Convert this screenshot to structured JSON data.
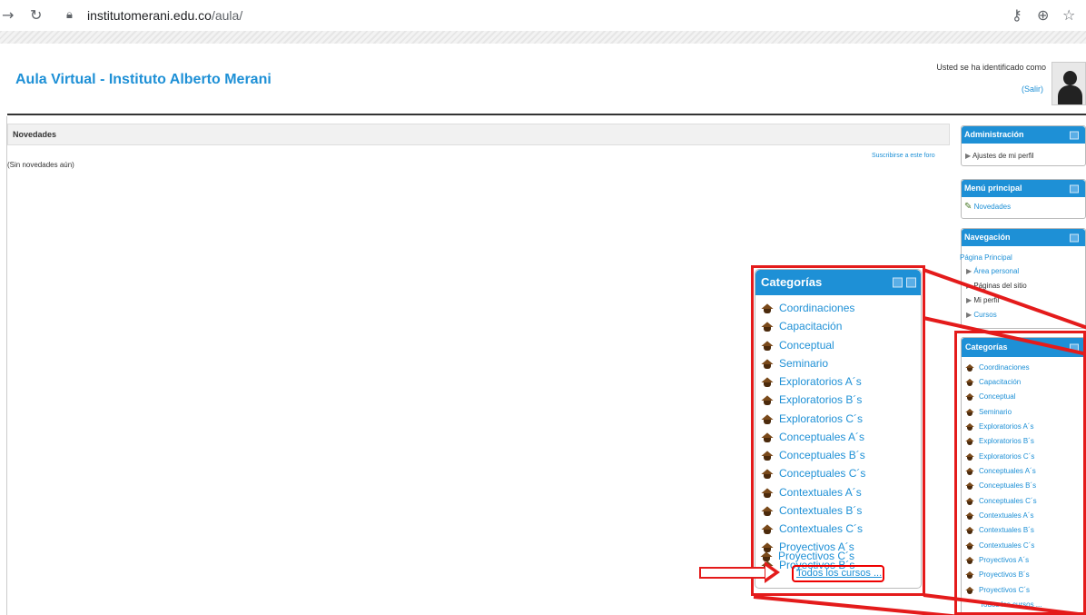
{
  "browser": {
    "back_icon": "back-arrow-icon",
    "reload_icon": "reload-icon",
    "lock_icon": "lock-icon",
    "url_domain": "institutomerani.edu.co",
    "url_path": "/aula/",
    "key_icon": "key-icon",
    "zoom_icon": "zoom-icon",
    "star_icon": "star-icon"
  },
  "header": {
    "site_title": "Aula Virtual - Instituto Alberto Merani",
    "login_text": "Usted se ha identificado como",
    "logout_link": "(Salir)"
  },
  "main": {
    "news_title": "Novedades",
    "subscribe_link": "Suscribirse a este foro",
    "no_news_text": "(Sin novedades aún)"
  },
  "admin_block": {
    "title": "Administración",
    "items": [
      "Ajustes de mi perfil"
    ]
  },
  "menu_block": {
    "title": "Menú principal",
    "items": [
      "Novedades"
    ]
  },
  "nav_block": {
    "title": "Navegación",
    "home": "Página Principal",
    "items": [
      "Área personal",
      "Páginas del sitio",
      "Mi perfil",
      "Cursos"
    ]
  },
  "categories_block": {
    "title": "Categorías",
    "items": [
      "Coordinaciones",
      "Capacitación",
      "Conceptual",
      "Seminario",
      "Exploratorios A´s",
      "Exploratorios B´s",
      "Exploratorios C´s",
      "Conceptuales A´s",
      "Conceptuales B´s",
      "Conceptuales C´s",
      "Contextuales A´s",
      "Contextuales B´s",
      "Contextuales C´s",
      "Proyectivos A´s",
      "Proyectivos B´s",
      "Proyectivos C´s"
    ],
    "all_courses": "Todos los cursos ..."
  },
  "colors": {
    "accent": "#1e90d6",
    "annotation": "#e41b1b"
  }
}
